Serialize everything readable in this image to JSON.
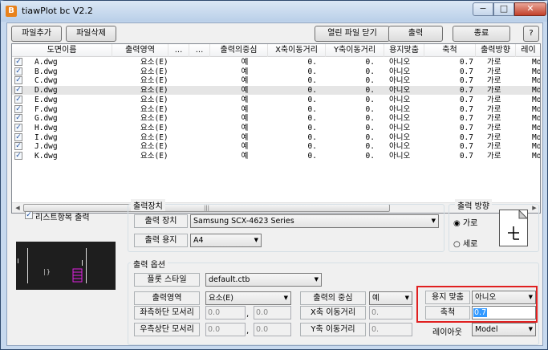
{
  "window": {
    "title": "tiawPlot bc V2.2",
    "minimize": "−",
    "maximize": "□",
    "close": "✕",
    "app_icon": "B"
  },
  "toolbar": {
    "add_file": "파일추가",
    "delete_file": "파일삭제",
    "close_open_files": "열린 파일 닫기",
    "print": "출력",
    "exit": "종료",
    "help": "?"
  },
  "list": {
    "headers": [
      "도면이름",
      "출력영역",
      "...",
      "...",
      "출력의중심",
      "X축이동거리",
      "Y축이동거리",
      "용지맞춤",
      "축척",
      "출력방향",
      "레이"
    ],
    "check_mark": "✓",
    "rows": [
      {
        "name": "A.dwg",
        "area": "요소(E)",
        "center": "예",
        "x": "0.",
        "y": "0.",
        "fit": "아니오",
        "scale": "0.7",
        "dir": "가로",
        "layout": "Mo"
      },
      {
        "name": "B.dwg",
        "area": "요소(E)",
        "center": "예",
        "x": "0.",
        "y": "0.",
        "fit": "아니오",
        "scale": "0.7",
        "dir": "가로",
        "layout": "Mo"
      },
      {
        "name": "C.dwg",
        "area": "요소(E)",
        "center": "예",
        "x": "0.",
        "y": "0.",
        "fit": "아니오",
        "scale": "0.7",
        "dir": "가로",
        "layout": "Mo"
      },
      {
        "name": "D.dwg",
        "area": "요소(E)",
        "center": "예",
        "x": "0.",
        "y": "0.",
        "fit": "아니오",
        "scale": "0.7",
        "dir": "가로",
        "layout": "Mo"
      },
      {
        "name": "E.dwg",
        "area": "요소(E)",
        "center": "예",
        "x": "0.",
        "y": "0.",
        "fit": "아니오",
        "scale": "0.7",
        "dir": "가로",
        "layout": "Mo"
      },
      {
        "name": "F.dwg",
        "area": "요소(E)",
        "center": "예",
        "x": "0.",
        "y": "0.",
        "fit": "아니오",
        "scale": "0.7",
        "dir": "가로",
        "layout": "Mo"
      },
      {
        "name": "G.dwg",
        "area": "요소(E)",
        "center": "예",
        "x": "0.",
        "y": "0.",
        "fit": "아니오",
        "scale": "0.7",
        "dir": "가로",
        "layout": "Mo"
      },
      {
        "name": "H.dwg",
        "area": "요소(E)",
        "center": "예",
        "x": "0.",
        "y": "0.",
        "fit": "아니오",
        "scale": "0.7",
        "dir": "가로",
        "layout": "Mo"
      },
      {
        "name": "I.dwg",
        "area": "요소(E)",
        "center": "예",
        "x": "0.",
        "y": "0.",
        "fit": "아니오",
        "scale": "0.7",
        "dir": "가로",
        "layout": "Mo"
      },
      {
        "name": "J.dwg",
        "area": "요소(E)",
        "center": "예",
        "x": "0.",
        "y": "0.",
        "fit": "아니오",
        "scale": "0.7",
        "dir": "가로",
        "layout": "Mo"
      },
      {
        "name": "K.dwg",
        "area": "요소(E)",
        "center": "예",
        "x": "0.",
        "y": "0.",
        "fit": "아니오",
        "scale": "0.7",
        "dir": "가로",
        "layout": "Mo"
      }
    ],
    "scroll_left": "◀",
    "scroll_right": "▶",
    "scroll_grip": "|||"
  },
  "list_print_option": {
    "label": "리스트항목 출력",
    "checked": true
  },
  "device": {
    "group_title": "출력장치",
    "device_label": "출력 장치",
    "device_value": "Samsung SCX-4623 Series",
    "paper_label": "출력 용지",
    "paper_value": "A4"
  },
  "orientation": {
    "group_title": "출력 방향",
    "landscape": "가로",
    "portrait": "세로",
    "selected": "가로"
  },
  "options": {
    "group_title": "출력 옵션",
    "plot_style_label": "플롯 스타일",
    "plot_style_value": "default.ctb",
    "area_label": "출력영역",
    "area_value": "요소(E)",
    "center_label": "출력의 중심",
    "center_value": "예",
    "lower_left_label": "좌측하단 모서리",
    "lower_left_x": "0.0",
    "lower_left_y": "0.0",
    "upper_right_label": "우측상단 모서리",
    "upper_right_x": "0.0",
    "upper_right_y": "0.0",
    "x_offset_label": "X축 이동거리",
    "x_offset_value": "0.",
    "y_offset_label": "Y축 이동거리",
    "y_offset_value": "0.",
    "fit_label": "용지 맞춤",
    "fit_value": "아니오",
    "scale_label": "축척",
    "scale_value": "0.7",
    "layout_label": "레이아웃",
    "layout_value": "Model",
    "comma": ","
  },
  "colors": {
    "highlight_box": "#e02020",
    "selection": "#3399ff"
  }
}
